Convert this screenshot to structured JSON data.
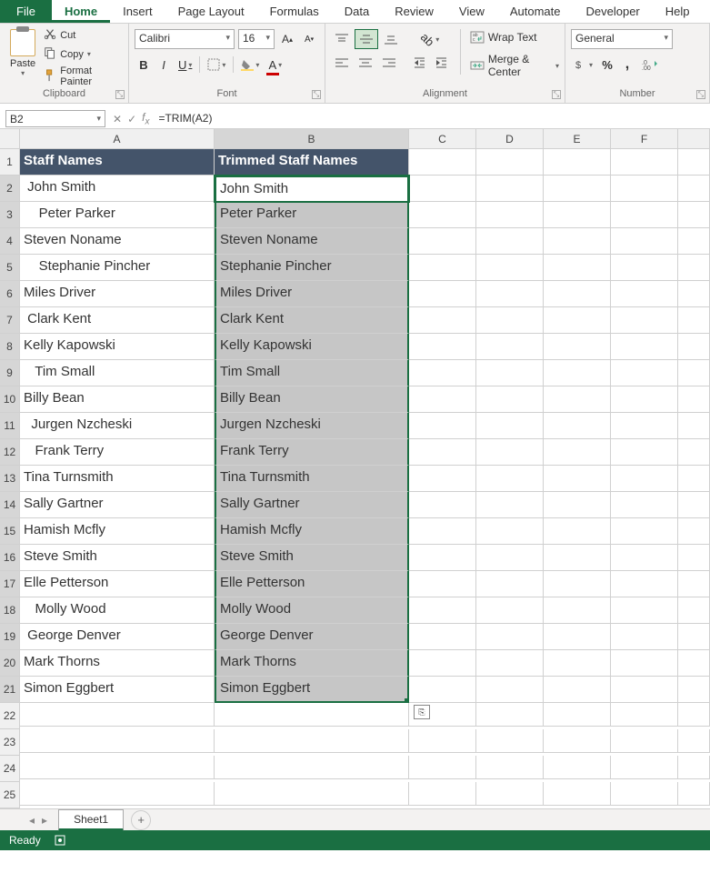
{
  "menu": {
    "file": "File",
    "tabs": [
      "Home",
      "Insert",
      "Page Layout",
      "Formulas",
      "Data",
      "Review",
      "View",
      "Automate",
      "Developer",
      "Help"
    ],
    "active": "Home"
  },
  "ribbon": {
    "clipboard": {
      "paste": "Paste",
      "cut": "Cut",
      "copy": "Copy",
      "format_painter": "Format Painter",
      "label": "Clipboard"
    },
    "font": {
      "name": "Calibri",
      "size": "16",
      "bold": "B",
      "italic": "I",
      "underline": "U",
      "label": "Font"
    },
    "alignment": {
      "wrap": "Wrap Text",
      "merge": "Merge & Center",
      "label": "Alignment"
    },
    "number": {
      "format": "General",
      "label": "Number"
    }
  },
  "namebox": "B2",
  "formula": "=TRIM(A2)",
  "columns": [
    "A",
    "B",
    "C",
    "D",
    "E",
    "F"
  ],
  "row_headers": [
    1,
    2,
    3,
    4,
    5,
    6,
    7,
    8,
    9,
    10,
    11,
    12,
    13,
    14,
    15,
    16,
    17,
    18,
    19,
    20,
    21,
    22,
    23,
    24,
    25
  ],
  "table": {
    "headerA": "Staff Names",
    "headerB": "Trimmed Staff Names",
    "rows": [
      {
        "a": " John Smith",
        "b": "John Smith"
      },
      {
        "a": "    Peter Parker",
        "b": "Peter Parker"
      },
      {
        "a": "Steven Noname",
        "b": "Steven Noname"
      },
      {
        "a": "    Stephanie Pincher",
        "b": "Stephanie Pincher"
      },
      {
        "a": "Miles Driver",
        "b": "Miles Driver"
      },
      {
        "a": " Clark Kent",
        "b": "Clark Kent"
      },
      {
        "a": "Kelly Kapowski",
        "b": "Kelly Kapowski"
      },
      {
        "a": "   Tim Small",
        "b": "Tim Small"
      },
      {
        "a": "Billy Bean",
        "b": "Billy Bean"
      },
      {
        "a": "  Jurgen Nzcheski",
        "b": "Jurgen Nzcheski"
      },
      {
        "a": "   Frank Terry",
        "b": "Frank Terry"
      },
      {
        "a": "Tina Turnsmith",
        "b": "Tina Turnsmith"
      },
      {
        "a": "Sally Gartner",
        "b": "Sally Gartner"
      },
      {
        "a": "Hamish Mcfly",
        "b": "Hamish Mcfly"
      },
      {
        "a": "Steve Smith",
        "b": "Steve Smith"
      },
      {
        "a": "Elle Petterson",
        "b": "Elle Petterson"
      },
      {
        "a": "   Molly Wood",
        "b": "Molly Wood"
      },
      {
        "a": " George Denver",
        "b": "George Denver"
      },
      {
        "a": "Mark Thorns",
        "b": "Mark Thorns"
      },
      {
        "a": "Simon Eggbert",
        "b": "Simon Eggbert"
      }
    ]
  },
  "sheet": {
    "name": "Sheet1"
  },
  "status": {
    "ready": "Ready"
  }
}
